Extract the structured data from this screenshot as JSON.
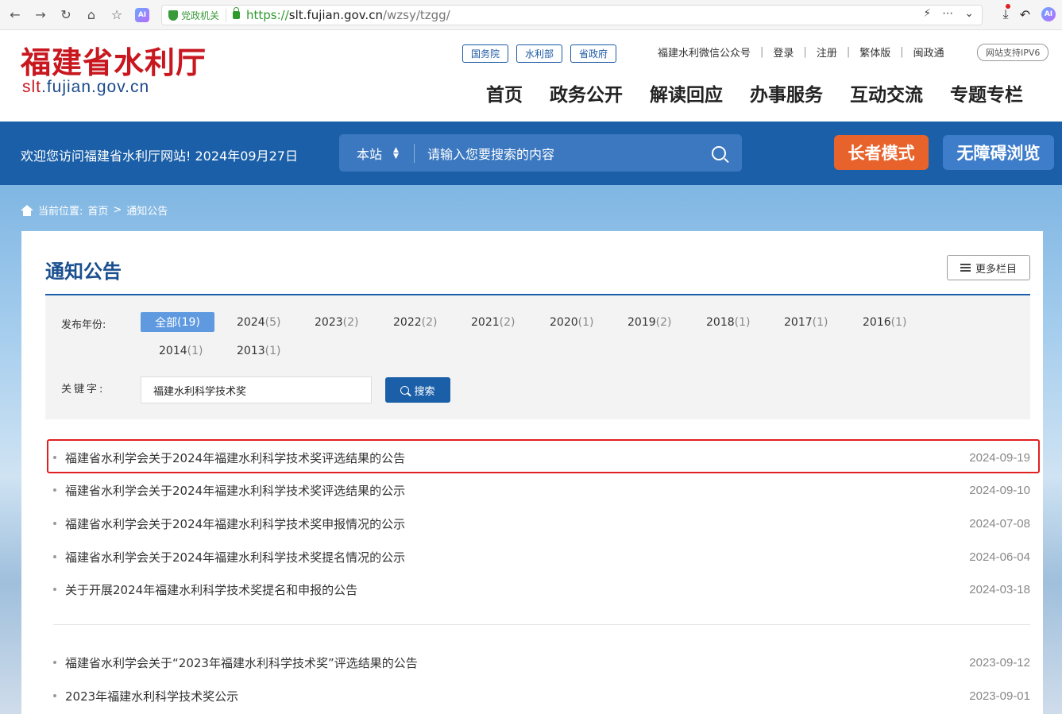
{
  "browser": {
    "gov_tag": "党政机关",
    "url_https": "https://",
    "url_domain": "slt.fujian.gov.cn",
    "url_path": "/wzsy/tzgg/"
  },
  "header": {
    "logo_cn": "福建省水利厅",
    "logo_en_red": "slt",
    "logo_en_rest": ".fujian.gov.cn",
    "quick_links": [
      "国务院",
      "水利部",
      "省政府"
    ],
    "top_links": [
      "福建水利微信公众号",
      "登录",
      "注册",
      "繁体版",
      "闽政通"
    ],
    "ipv6": "网站支持IPV6",
    "nav": [
      "首页",
      "政务公开",
      "解读回应",
      "办事服务",
      "互动交流",
      "专题专栏"
    ]
  },
  "bluebar": {
    "welcome": "欢迎您访问福建省水利厅网站! 2024年09月27日",
    "site_select": "本站",
    "search_placeholder": "请输入您要搜索的内容",
    "elder_mode": "长者模式",
    "accessibility": "无障碍浏览"
  },
  "breadcrumb": {
    "prefix": "当前位置:",
    "home": "首页",
    "sep": ">",
    "current": "通知公告"
  },
  "main": {
    "title": "通知公告",
    "more_columns": "更多栏目",
    "filter": {
      "year_label": "发布年份:",
      "years": [
        {
          "label": "全部",
          "count": "(19)"
        },
        {
          "label": "2024",
          "count": "(5)"
        },
        {
          "label": "2023",
          "count": "(2)"
        },
        {
          "label": "2022",
          "count": "(2)"
        },
        {
          "label": "2021",
          "count": "(2)"
        },
        {
          "label": "2020",
          "count": "(1)"
        },
        {
          "label": "2019",
          "count": "(2)"
        },
        {
          "label": "2018",
          "count": "(1)"
        },
        {
          "label": "2017",
          "count": "(1)"
        },
        {
          "label": "2016",
          "count": "(1)"
        },
        {
          "label": "2014",
          "count": "(1)"
        },
        {
          "label": "2013",
          "count": "(1)"
        }
      ],
      "keyword_label": "关键字:",
      "keyword_value": "福建水利科学技术奖",
      "search_button": "搜索"
    },
    "news": [
      {
        "title": "福建省水利学会关于2024年福建水利科学技术奖评选结果的公告",
        "date": "2024-09-19"
      },
      {
        "title": "福建省水利学会关于2024年福建水利科学技术奖评选结果的公示",
        "date": "2024-09-10"
      },
      {
        "title": "福建省水利学会关于2024年福建水利科学技术奖申报情况的公示",
        "date": "2024-07-08"
      },
      {
        "title": "福建省水利学会关于2024年福建水利科学技术奖提名情况的公示",
        "date": "2024-06-04"
      },
      {
        "title": "关于开展2024年福建水利科学技术奖提名和申报的公告",
        "date": "2024-03-18"
      },
      {
        "title": "福建省水利学会关于“2023年福建水利科学技术奖”评选结果的公告",
        "date": "2023-09-12"
      },
      {
        "title": "2023年福建水利科学技术奖公示",
        "date": "2023-09-01"
      }
    ]
  },
  "colors": {
    "brand_red": "#c8171f",
    "brand_blue": "#1a5fa8",
    "elder_orange": "#e8632c",
    "highlight_red": "#e02020"
  }
}
